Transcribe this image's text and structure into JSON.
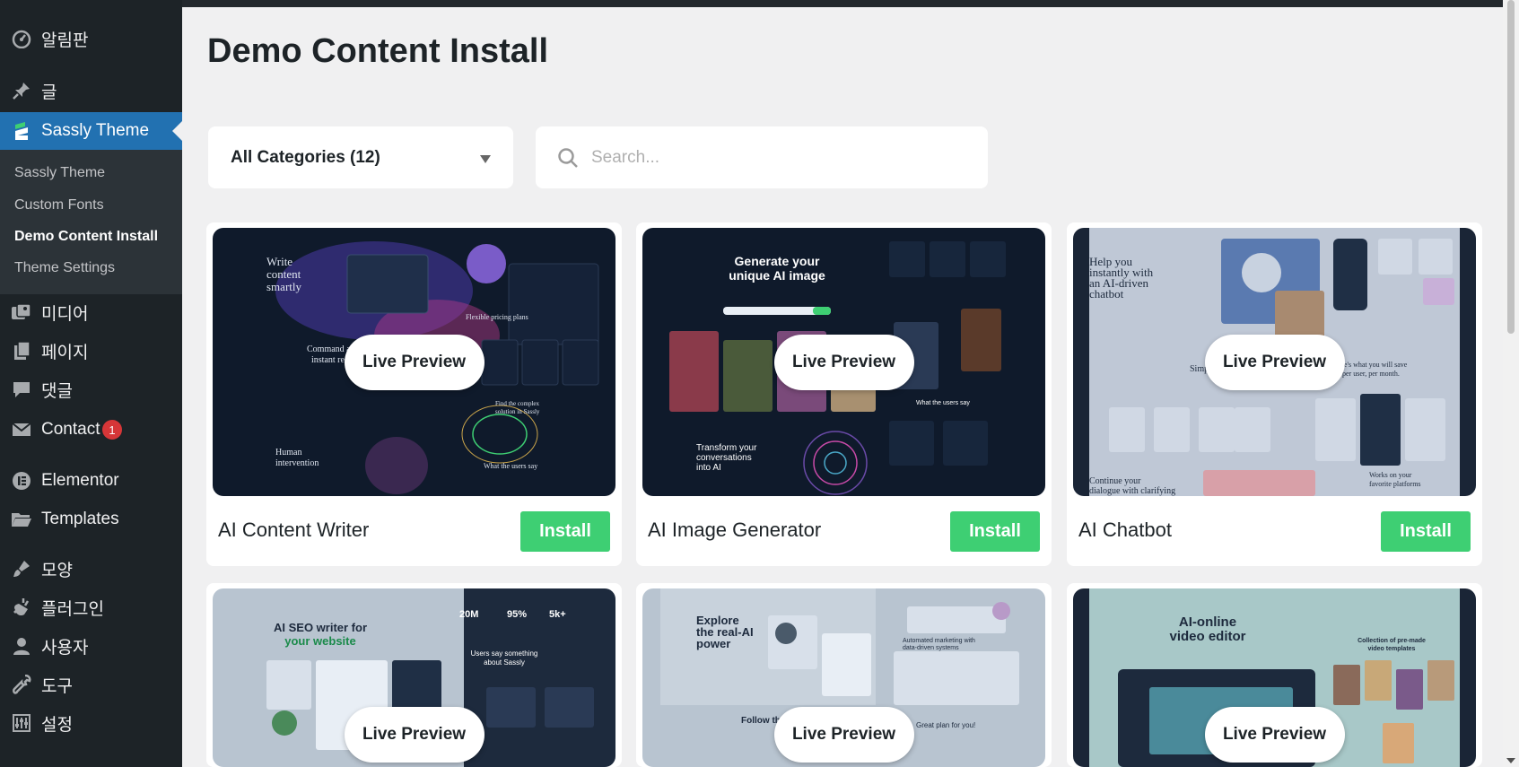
{
  "sidebar": {
    "items": [
      {
        "label": "알림판",
        "icon": "dashboard-icon"
      },
      {
        "label": "글",
        "icon": "pin-icon"
      },
      {
        "label": "Sassly Theme",
        "icon": "sassly-logo-icon"
      },
      {
        "label": "미디어",
        "icon": "media-icon"
      },
      {
        "label": "페이지",
        "icon": "pages-icon"
      },
      {
        "label": "댓글",
        "icon": "comments-icon"
      },
      {
        "label": "Contact",
        "icon": "mail-icon",
        "badge": "1"
      },
      {
        "label": "Elementor",
        "icon": "elementor-icon"
      },
      {
        "label": "Templates",
        "icon": "folder-icon"
      },
      {
        "label": "모양",
        "icon": "appearance-icon"
      },
      {
        "label": "플러그인",
        "icon": "plugins-icon"
      },
      {
        "label": "사용자",
        "icon": "users-icon"
      },
      {
        "label": "도구",
        "icon": "tools-icon"
      },
      {
        "label": "설정",
        "icon": "settings-icon"
      }
    ],
    "submenu": [
      {
        "label": "Sassly Theme"
      },
      {
        "label": "Custom Fonts"
      },
      {
        "label": "Demo Content Install"
      },
      {
        "label": "Theme Settings"
      }
    ]
  },
  "page": {
    "title": "Demo Content Install"
  },
  "filters": {
    "category_value": "All Categories (12)",
    "search_placeholder": "Search..."
  },
  "cards": [
    {
      "name": "AI Content Writer",
      "preview_label": "Live Preview",
      "install_label": "Install"
    },
    {
      "name": "AI Image Generator",
      "preview_label": "Live Preview",
      "install_label": "Install"
    },
    {
      "name": "AI Chatbot",
      "preview_label": "Live Preview",
      "install_label": "Install"
    },
    {
      "name": "",
      "preview_label": "Live Preview",
      "install_label": ""
    },
    {
      "name": "",
      "preview_label": "Live Preview",
      "install_label": ""
    },
    {
      "name": "",
      "preview_label": "Live Preview",
      "install_label": ""
    }
  ],
  "thumb_text": {
    "t1": [
      "Write",
      "content",
      "smartly",
      "Flexible pricing plans",
      "Command and",
      "instant re",
      "Find the complex",
      "solution in Sassly",
      "Human",
      "intervention",
      "What the users say"
    ],
    "t2": [
      "Generate your",
      "unique AI image",
      "Transform your",
      "conversations",
      "into AI",
      "What the users say"
    ],
    "t3": [
      "Help you",
      "instantly with",
      "an AI-driven",
      "chatbot",
      "Simple",
      "Here's what you will save",
      "per user, per month.",
      "Continue your",
      "dialogue with clarifying",
      "Works on your",
      "favorite platforms"
    ],
    "t4": [
      "AI SEO writer for",
      "your website",
      "20M",
      "95%",
      "5k+",
      "Users say something",
      "about Sassly"
    ],
    "t5": [
      "Explore",
      "the real-AI",
      "power",
      "Automated marketing with",
      "data-driven systems",
      "Follow the",
      "Great plan for you!"
    ],
    "t6": [
      "AI-online",
      "video editor",
      "Collection of pre-made",
      "video templates"
    ]
  },
  "colors": {
    "sidebar_bg": "#1d2327",
    "active_blue": "#2271b1",
    "install_green": "#3ecf73",
    "badge_red": "#d63638"
  }
}
